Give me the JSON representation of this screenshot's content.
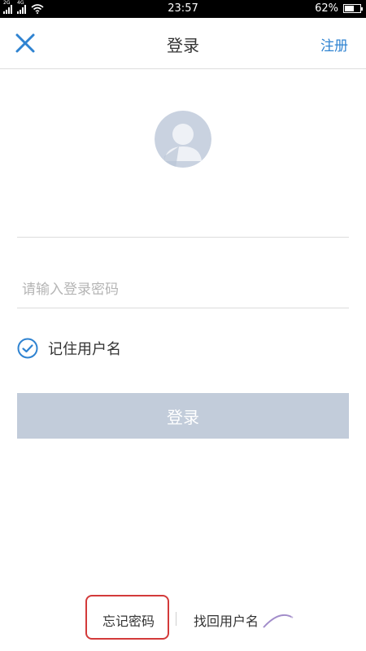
{
  "status_bar": {
    "signal_tag_1": "2G",
    "signal_tag_2": "4G",
    "time": "23:57",
    "battery": "62%",
    "battery_level": 0.62
  },
  "nav": {
    "title": "登录",
    "register_label": "注册",
    "close_icon": "close-icon"
  },
  "form": {
    "username_value": "",
    "password_placeholder": "请输入登录密码",
    "remember_label": "记住用户名",
    "remember_checked": true,
    "login_label": "登录"
  },
  "footer": {
    "forgot_password_label": "忘记密码",
    "find_username_label": "找回用户名"
  },
  "colors": {
    "accent": "#2f83d1",
    "button_disabled": "#c2ccda",
    "highlight": "#d33a3a"
  }
}
